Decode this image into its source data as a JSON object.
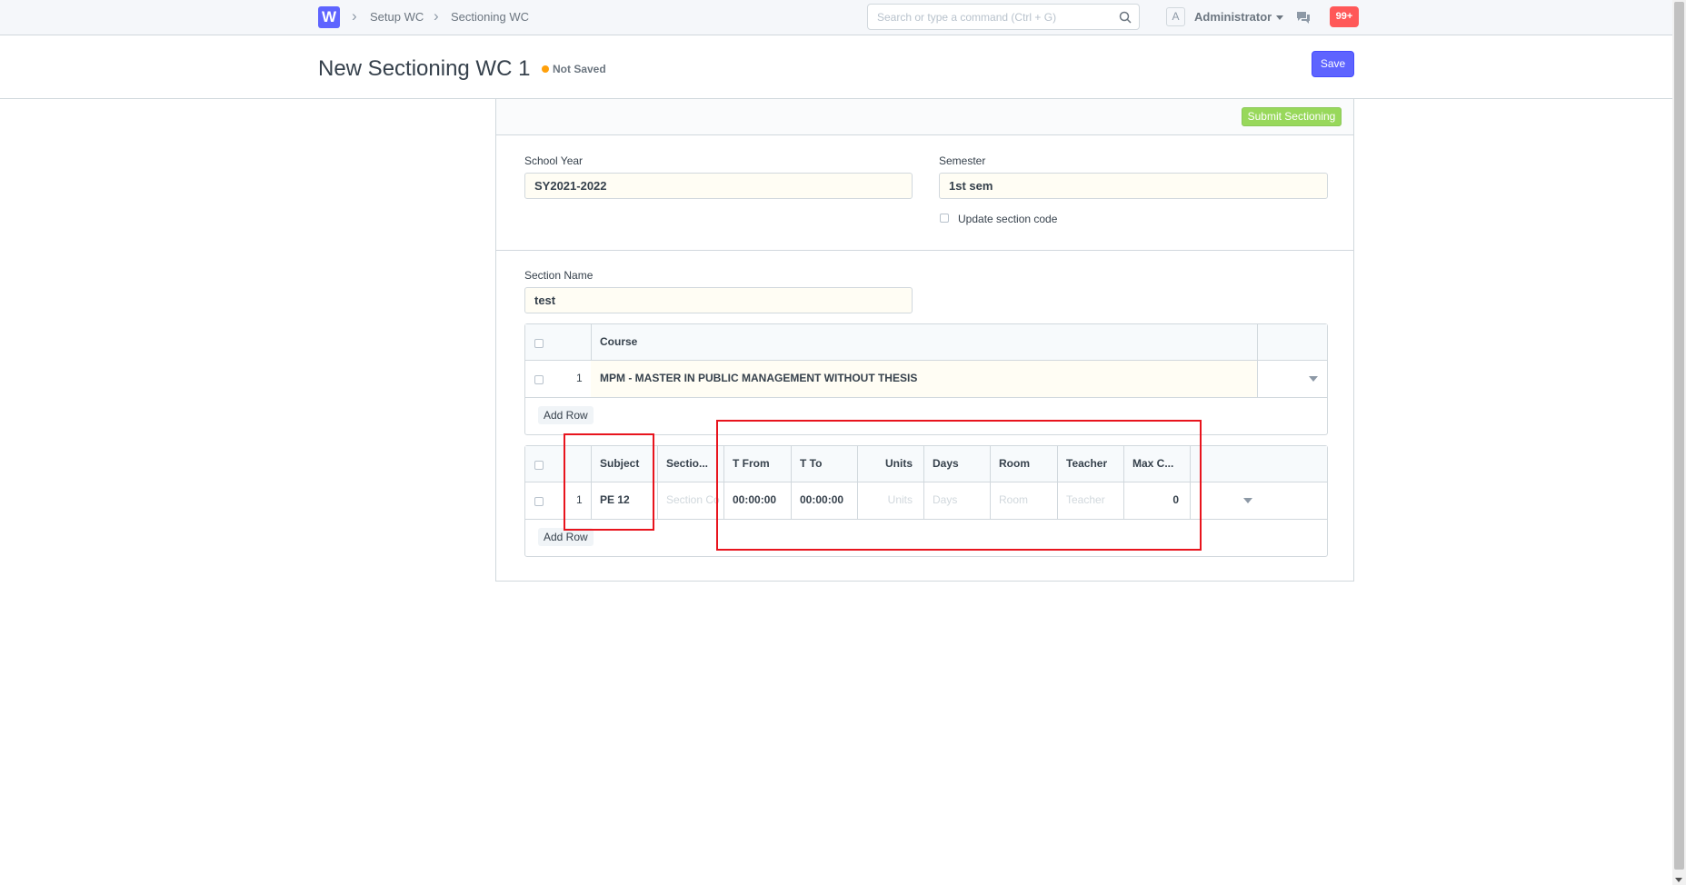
{
  "navbar": {
    "logo_letter": "W",
    "breadcrumbs": [
      "Setup WC",
      "Sectioning WC"
    ],
    "search_placeholder": "Search or type a command (Ctrl + G)",
    "avatar_letter": "A",
    "user_name": "Administrator",
    "notifications": "99+"
  },
  "page": {
    "title": "New Sectioning WC 1",
    "status": "Not Saved",
    "save_label": "Save"
  },
  "toolbar": {
    "submit_label": "Submit Sectioning"
  },
  "form": {
    "school_year_label": "School Year",
    "school_year": "SY2021-2022",
    "semester_label": "Semester",
    "semester": "1st sem",
    "update_code_label": "Update section code",
    "section_name_label": "Section Name",
    "section_name": "test"
  },
  "course_table": {
    "header": "Course",
    "rows": [
      {
        "no": "1",
        "course": "MPM - MASTER IN PUBLIC MANAGEMENT WITHOUT THESIS"
      }
    ],
    "add_row": "Add Row"
  },
  "subject_table": {
    "headers": {
      "subject": "Subject",
      "section": "Sectio...",
      "t_from": "T From",
      "t_to": "T To",
      "units": "Units",
      "days": "Days",
      "room": "Room",
      "teacher": "Teacher",
      "max": "Max C..."
    },
    "rows": [
      {
        "no": "1",
        "subject": "PE 12",
        "section": "Section Co",
        "t_from": "00:00:00",
        "t_to": "00:00:00",
        "units": "Units",
        "days": "Days",
        "room": "Room",
        "teacher": "Teacher",
        "max": "0"
      }
    ],
    "add_row": "Add Row"
  },
  "colors": {
    "primary": "#5e64ff",
    "success": "#98d85b",
    "annotation": "#e8141d",
    "notification": "#ff5858",
    "status_dot": "#ffa00a"
  }
}
